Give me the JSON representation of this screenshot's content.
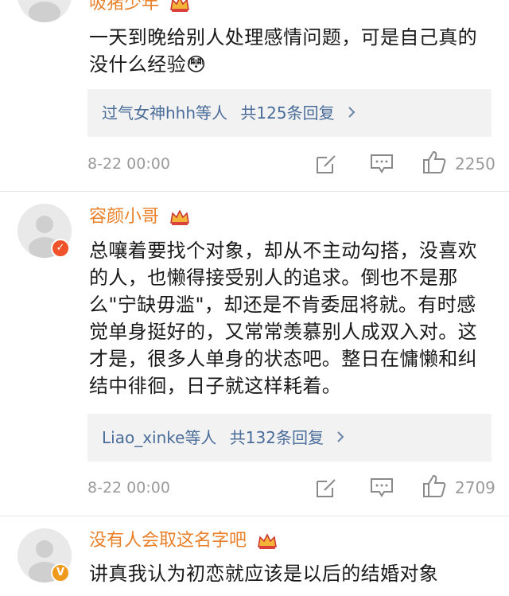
{
  "comments": [
    {
      "username": "吸猪少年",
      "text": "一天到晚给别人处理感情问题，可是自己真的没什么经验😳",
      "replies": {
        "names": "过气女神hhh等人",
        "count_label": "共125条回复"
      },
      "date": "8-22 00:00",
      "likes": "2250"
    },
    {
      "username": "容颜小哥",
      "text": "总嚷着要找个对象，却从不主动勾搭，没喜欢的人，也懒得接受别人的追求。倒也不是那么\"宁缺毋滥\"，却还是不肯委屈将就。有时感觉单身挺好的，又常常羡慕别人成双入对。这才是，很多人单身的状态吧。整日在慵懒和纠结中徘徊，日子就这样耗着。",
      "replies": {
        "names": "Liao_xinke等人",
        "count_label": "共132条回复"
      },
      "date": "8-22 00:00",
      "likes": "2709"
    },
    {
      "username": "没有人会取这名字吧",
      "text": "讲真我认为初恋就应该是以后的结婚对象"
    }
  ],
  "colors": {
    "username": "#e9802a",
    "link": "#4a6c9a",
    "meta": "#9a9a9a"
  },
  "icons": [
    "user-avatar-icon",
    "crown-icon",
    "edit-icon",
    "comment-icon",
    "like-icon",
    "chevron-right-icon"
  ]
}
